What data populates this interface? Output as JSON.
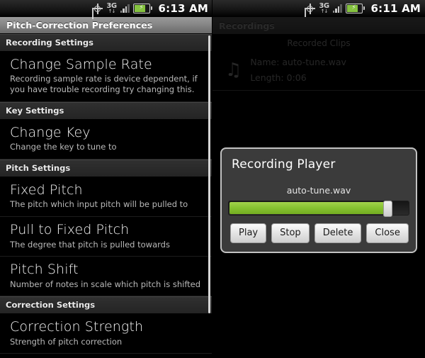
{
  "left_phone": {
    "statusbar": {
      "gps_icon": "gps-icon",
      "network_label": "3G",
      "network_arrows": "↑↓",
      "signal_icon": "signal-bars-icon",
      "battery_icon": "battery-charging-icon",
      "battery_bolt": "⚡",
      "time": "6:13 AM"
    },
    "title": "Pitch-Correction Preferences",
    "sections": [
      {
        "header": "Recording Settings",
        "items": [
          {
            "title": "Change Sample Rate",
            "subtitle": "Recording sample rate is device dependent, if you have trouble recording try changing this."
          }
        ]
      },
      {
        "header": "Key Settings",
        "items": [
          {
            "title": "Change Key",
            "subtitle": "Change the key to tune to"
          }
        ]
      },
      {
        "header": "Pitch Settings",
        "items": [
          {
            "title": "Fixed Pitch",
            "subtitle": "The pitch which input pitch will be pulled to"
          },
          {
            "title": "Pull to Fixed Pitch",
            "subtitle": "The degree that pitch is pulled towards"
          },
          {
            "title": "Pitch Shift",
            "subtitle": "Number of notes in scale which pitch is shifted"
          }
        ]
      },
      {
        "header": "Correction Settings",
        "items": [
          {
            "title": "Correction Strength",
            "subtitle": "Strength of pitch correction"
          }
        ]
      }
    ]
  },
  "right_phone": {
    "statusbar": {
      "network_label": "3G",
      "network_arrows": "↑↓",
      "time": "6:11 AM"
    },
    "title": "Recordings",
    "subheader": "Recorded Clips",
    "clip": {
      "icon": "music-note-icon",
      "icon_glyph": "♫",
      "name_line": "Name: auto-tune.wav",
      "length_line": "Length: 0:06"
    },
    "dialog": {
      "title": "Recording Player",
      "filename": "auto-tune.wav",
      "progress_percent": 88,
      "buttons": [
        {
          "label": "Play"
        },
        {
          "label": "Stop"
        },
        {
          "label": "Delete"
        },
        {
          "label": "Close"
        }
      ]
    }
  },
  "colors": {
    "accent_green": "#87c332",
    "titlebar_gray": "#868686",
    "dialog_bg": "#3b3b3b",
    "dialog_border": "#c2c2c2"
  }
}
